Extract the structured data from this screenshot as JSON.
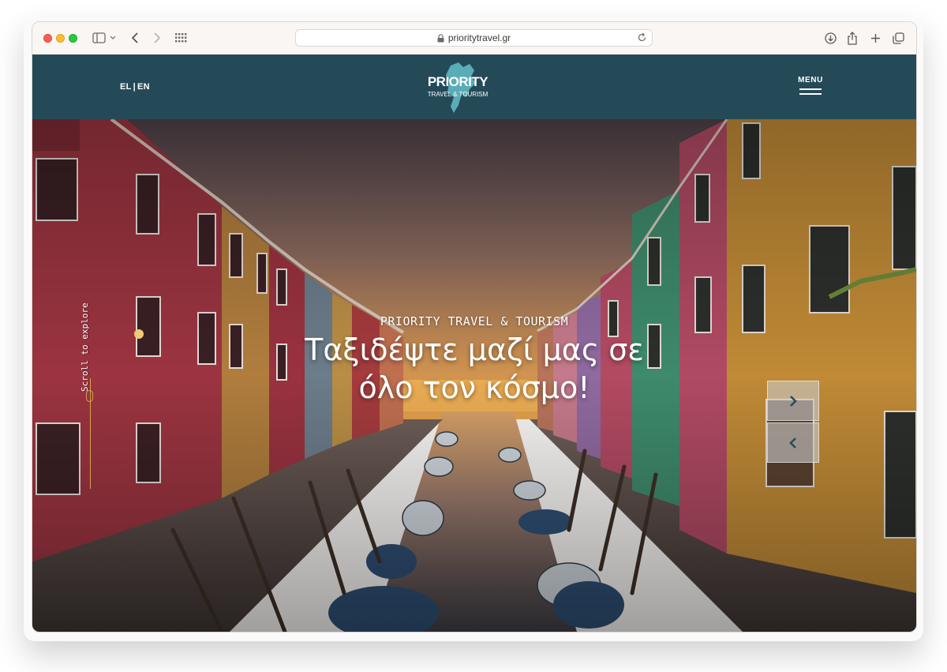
{
  "browser": {
    "url": "prioritytravel.gr"
  },
  "header": {
    "lang_el": "EL",
    "lang_sep": "|",
    "lang_en": "EN",
    "logo_title": "PRIORITY",
    "logo_subtitle": "TRAVEL & TOURISM",
    "menu_label": "MENU"
  },
  "hero": {
    "eyebrow": "PRIORITY TRAVEL & TOURISM",
    "title": "Ταξιδέψτε μαζί μας σε όλο τον κόσμο!",
    "scroll_label": "Scroll to explore"
  },
  "colors": {
    "header_bg": "#244a58",
    "accent_gold": "#d4a24c",
    "logo_teal": "#5fb8c2"
  },
  "icons": {
    "next": "chevron-right-icon",
    "prev": "chevron-left-icon"
  }
}
